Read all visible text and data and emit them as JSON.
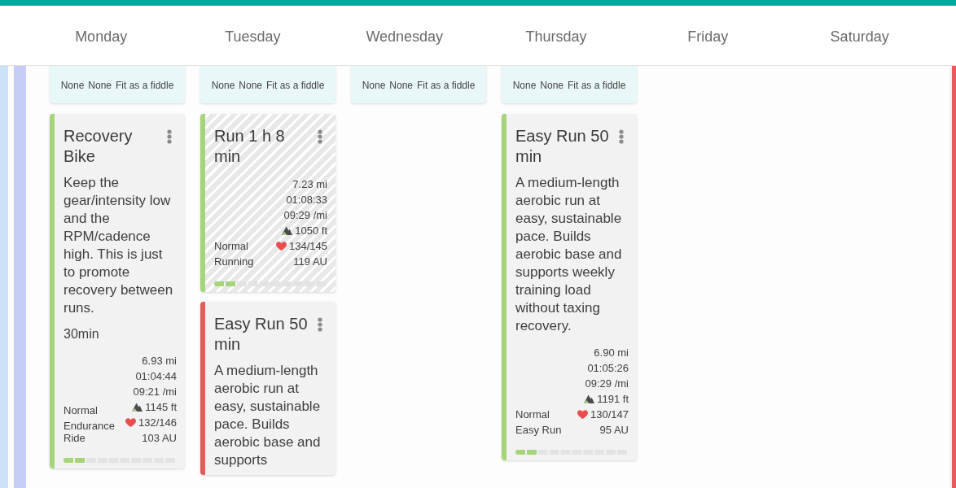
{
  "days": [
    {
      "name": "Monday",
      "cards": [
        {
          "kind": "wellness",
          "values": [
            "None",
            "None",
            "Fit as a fiddle"
          ]
        },
        {
          "kind": "workout",
          "title": "Recovery Bike",
          "color": "#a6d47a",
          "completed": false,
          "description": "Keep the gear/intensity low and the RPM/cadence high. This is just to promote recovery between runs.",
          "duration": "30min",
          "distance": "6.93 mi",
          "time": "01:04:44",
          "pace": "09:21 /mi",
          "elevation": "1145 ft",
          "heart_rate": "132/146",
          "load": "103 AU",
          "labels": [
            "Normal",
            "Endurance Ride"
          ],
          "level": 0.2
        }
      ]
    },
    {
      "name": "Tuesday",
      "cards": [
        {
          "kind": "wellness",
          "values": [
            "None",
            "None",
            "Fit as a fiddle"
          ]
        },
        {
          "kind": "workout",
          "title": "Run 1 h 8 min",
          "color": "#a6d47a",
          "completed": true,
          "distance": "7.23 mi",
          "time": "01:08:33",
          "pace": "09:29 /mi",
          "elevation": "1050 ft",
          "heart_rate": "134/145",
          "load": "119 AU",
          "labels": [
            "Normal",
            "Running"
          ],
          "level": 0.2
        },
        {
          "kind": "workout",
          "title": "Easy Run 50 min",
          "color": "#e85b5b",
          "completed": false,
          "description": "A medium-length aerobic run at easy, sustainable pace. Builds aerobic base and supports"
        }
      ]
    },
    {
      "name": "Wednesday",
      "cards": [
        {
          "kind": "wellness",
          "values": [
            "None",
            "None",
            "Fit as a fiddle"
          ]
        }
      ]
    },
    {
      "name": "Thursday",
      "cards": [
        {
          "kind": "wellness",
          "values": [
            "None",
            "None",
            "Fit as a fiddle"
          ]
        },
        {
          "kind": "workout",
          "title": "Easy Run 50 min",
          "color": "#a6d47a",
          "completed": false,
          "description": "A medium-length aerobic run at easy, sustainable pace. Builds aerobic base and supports weekly training load without taxing recovery.",
          "distance": "6.90 mi",
          "time": "01:05:26",
          "pace": "09:29 /mi",
          "elevation": "1191 ft",
          "heart_rate": "130/147",
          "load": "95 AU",
          "labels": [
            "Normal",
            "Easy Run"
          ],
          "level": 0.2
        }
      ]
    },
    {
      "name": "Friday"
    },
    {
      "name": "Saturday"
    }
  ]
}
